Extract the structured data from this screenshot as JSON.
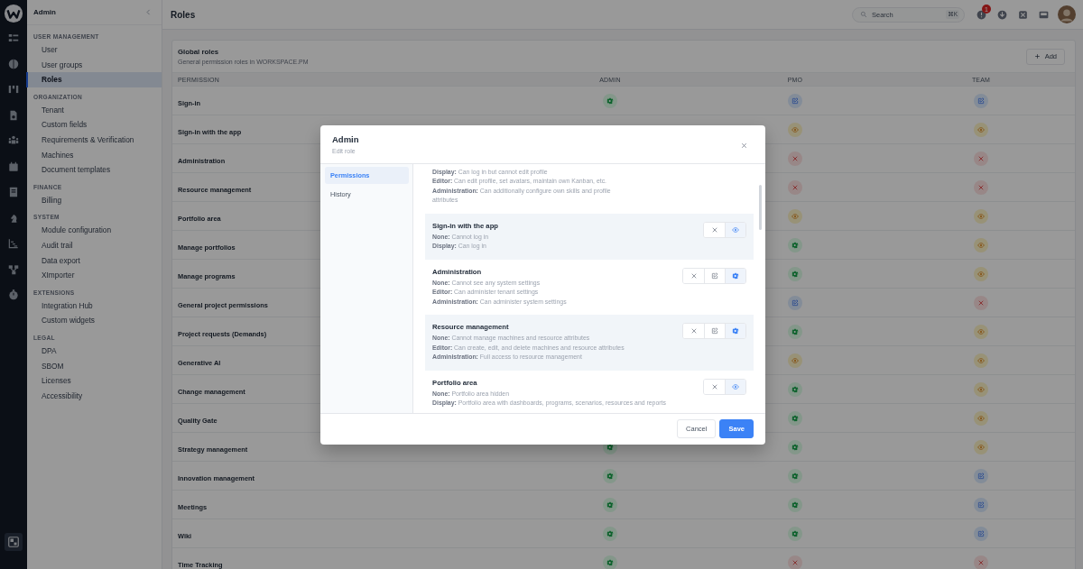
{
  "icon_rail": [
    {
      "selected": false
    },
    {
      "selected": false
    },
    {
      "selected": false
    },
    {
      "selected": false
    },
    {
      "selected": false
    },
    {
      "selected": false
    },
    {
      "selected": false
    },
    {
      "selected": false
    },
    {
      "selected": false
    },
    {
      "selected": false
    },
    {
      "selected": false
    },
    {
      "selected": true
    }
  ],
  "sidebar": {
    "title": "Admin",
    "sections": [
      {
        "heading": "USER MANAGEMENT",
        "items": [
          {
            "label": "User",
            "selected": false
          },
          {
            "label": "User groups",
            "selected": false
          },
          {
            "label": "Roles",
            "selected": true
          }
        ]
      },
      {
        "heading": "ORGANIZATION",
        "items": [
          {
            "label": "Tenant",
            "selected": false
          },
          {
            "label": "Custom fields",
            "selected": false
          },
          {
            "label": "Requirements & Verification",
            "selected": false
          },
          {
            "label": "Machines",
            "selected": false
          },
          {
            "label": "Document templates",
            "selected": false
          }
        ]
      },
      {
        "heading": "FINANCE",
        "items": [
          {
            "label": "Billing",
            "selected": false
          }
        ]
      },
      {
        "heading": "SYSTEM",
        "items": [
          {
            "label": "Module configuration",
            "selected": false
          },
          {
            "label": "Audit trail",
            "selected": false
          },
          {
            "label": "Data export",
            "selected": false
          },
          {
            "label": "XImporter",
            "selected": false
          }
        ]
      },
      {
        "heading": "EXTENSIONS",
        "items": [
          {
            "label": "Integration Hub",
            "selected": false
          },
          {
            "label": "Custom widgets",
            "selected": false
          }
        ]
      },
      {
        "heading": "LEGAL",
        "items": [
          {
            "label": "DPA",
            "selected": false
          },
          {
            "label": "SBOM",
            "selected": false
          },
          {
            "label": "Licenses",
            "selected": false
          },
          {
            "label": "Accessibility",
            "selected": false
          }
        ]
      }
    ]
  },
  "header": {
    "title": "Roles",
    "search": {
      "placeholder": "Search",
      "shortcut": "⌘K"
    },
    "notification_count": "1"
  },
  "card": {
    "title": "Global roles",
    "subtitle": "General permission roles in WORKSPACE.PM",
    "add_button": "Add"
  },
  "table": {
    "columns": [
      "PERMISSION",
      "ADMIN",
      "PMO",
      "TEAM"
    ],
    "rows": [
      {
        "name": "Sign-in",
        "admin": {
          "kind": "admin"
        },
        "pmo": {
          "kind": "editor"
        },
        "team": {
          "kind": "editor"
        }
      },
      {
        "name": "Sign-in with the app",
        "pmo": {
          "kind": "display"
        },
        "team": {
          "kind": "display"
        }
      },
      {
        "name": "Administration",
        "pmo": {
          "kind": "none"
        },
        "team": {
          "kind": "none"
        }
      },
      {
        "name": "Resource management",
        "pmo": {
          "kind": "none"
        },
        "team": {
          "kind": "none"
        }
      },
      {
        "name": "Portfolio area",
        "pmo": {
          "kind": "display"
        },
        "team": {
          "kind": "display"
        }
      },
      {
        "name": "Manage portfolios",
        "pmo": {
          "kind": "admin"
        },
        "team": {
          "kind": "display"
        }
      },
      {
        "name": "Manage programs",
        "pmo": {
          "kind": "admin"
        },
        "team": {
          "kind": "display"
        }
      },
      {
        "name": "General project permissions",
        "pmo": {
          "kind": "editor"
        },
        "team": {
          "kind": "none"
        }
      },
      {
        "name": "Project requests (Demands)",
        "pmo": {
          "kind": "admin"
        },
        "team": {
          "kind": "display"
        }
      },
      {
        "name": "Generative AI",
        "pmo": {
          "kind": "display"
        },
        "team": {
          "kind": "display"
        }
      },
      {
        "name": "Change management",
        "pmo": {
          "kind": "admin"
        },
        "team": {
          "kind": "display"
        }
      },
      {
        "name": "Quality Gate",
        "pmo": {
          "kind": "admin"
        },
        "team": {
          "kind": "display"
        }
      },
      {
        "name": "Strategy management",
        "admin": {
          "kind": "admin"
        },
        "pmo": {
          "kind": "admin"
        },
        "team": {
          "kind": "display"
        }
      },
      {
        "name": "Innovation management",
        "admin": {
          "kind": "admin"
        },
        "pmo": {
          "kind": "admin"
        },
        "team": {
          "kind": "editor"
        }
      },
      {
        "name": "Meetings",
        "admin": {
          "kind": "admin"
        },
        "pmo": {
          "kind": "admin"
        },
        "team": {
          "kind": "editor"
        }
      },
      {
        "name": "Wiki",
        "admin": {
          "kind": "admin"
        },
        "pmo": {
          "kind": "admin"
        },
        "team": {
          "kind": "editor"
        }
      },
      {
        "name": "Time Tracking",
        "admin": {
          "kind": "admin"
        },
        "pmo": {
          "kind": "none"
        },
        "team": {
          "kind": "none"
        }
      }
    ]
  },
  "dialog": {
    "title": "Admin",
    "subtitle": "Edit role",
    "tabs": [
      {
        "label": "Permissions",
        "selected": true
      },
      {
        "label": "History",
        "selected": false
      }
    ],
    "permissions": [
      {
        "lines": [
          "**Display:** Can log in but cannot edit profile",
          "**Editor:** Can edit profile, set avatars, maintain own Kanban, etc.",
          "**Administration:** Can additionally configure own skills and profile attributes"
        ]
      },
      {
        "title": "Sign-in with the app",
        "lines": [
          "**None:** Cannot log in",
          "**Display:** Can log in"
        ],
        "options": [
          {
            "kind": "none",
            "selected": false
          },
          {
            "kind": "display",
            "selected": true
          }
        ]
      },
      {
        "title": "Administration",
        "lines": [
          "**None:** Cannot see any system settings",
          "**Editor:** Can administer tenant settings",
          "**Administration:** Can administer system settings"
        ],
        "options": [
          {
            "kind": "none",
            "selected": false
          },
          {
            "kind": "editor",
            "selected": false
          },
          {
            "kind": "admin",
            "selected": true
          }
        ]
      },
      {
        "title": "Resource management",
        "lines": [
          "**None:** Cannot manage machines and resource attributes",
          "**Editor:** Can create, edit, and delete machines and resource attributes",
          "**Administration:** Full access to resource management"
        ],
        "options": [
          {
            "kind": "none",
            "selected": false
          },
          {
            "kind": "editor",
            "selected": false
          },
          {
            "kind": "admin",
            "selected": true
          }
        ]
      },
      {
        "title": "Portfolio area",
        "lines": [
          "**None:** Portfolio area hidden",
          "**Display:** Portfolio area with dashboards, programs, scenarios, resources and reports"
        ],
        "options": [
          {
            "kind": "none",
            "selected": false
          },
          {
            "kind": "display",
            "selected": true
          }
        ]
      }
    ],
    "cancel_button": "Cancel",
    "save_button": "Save"
  }
}
